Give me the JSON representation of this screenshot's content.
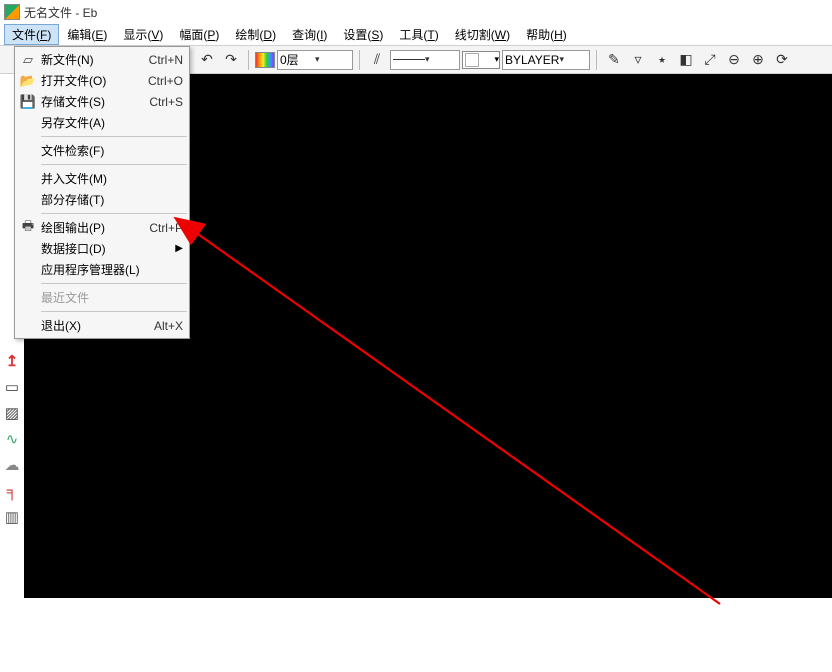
{
  "title": "无名文件 - Eb",
  "menubar": [
    {
      "label": "文件",
      "key": "F"
    },
    {
      "label": "编辑",
      "key": "E"
    },
    {
      "label": "显示",
      "key": "V"
    },
    {
      "label": "幅面",
      "key": "P"
    },
    {
      "label": "绘制",
      "key": "D"
    },
    {
      "label": "查询",
      "key": "I"
    },
    {
      "label": "设置",
      "key": "S"
    },
    {
      "label": "工具",
      "key": "T"
    },
    {
      "label": "线切割",
      "key": "W"
    },
    {
      "label": "帮助",
      "key": "H"
    }
  ],
  "toolbar": {
    "layer_label": "0层",
    "bylayer_label": "BYLAYER"
  },
  "file_menu": {
    "items": [
      {
        "icon": "new",
        "label": "新文件(N)",
        "shortcut": "Ctrl+N"
      },
      {
        "icon": "open",
        "label": "打开文件(O)",
        "shortcut": "Ctrl+O"
      },
      {
        "icon": "save",
        "label": "存储文件(S)",
        "shortcut": "Ctrl+S"
      },
      {
        "icon": "",
        "label": "另存文件(A)",
        "shortcut": ""
      },
      {
        "sep": true
      },
      {
        "icon": "",
        "label": "文件检索(F)",
        "shortcut": ""
      },
      {
        "sep": true
      },
      {
        "icon": "",
        "label": "并入文件(M)",
        "shortcut": ""
      },
      {
        "icon": "",
        "label": "部分存储(T)",
        "shortcut": ""
      },
      {
        "sep": true
      },
      {
        "icon": "print",
        "label": "绘图输出(P)",
        "shortcut": "Ctrl+P"
      },
      {
        "icon": "",
        "label": "数据接口(D)",
        "shortcut": "",
        "submenu": true
      },
      {
        "icon": "",
        "label": "应用程序管理器(L)",
        "shortcut": ""
      },
      {
        "sep": true
      },
      {
        "icon": "",
        "label": "最近文件",
        "shortcut": "",
        "disabled": true
      },
      {
        "sep": true
      },
      {
        "icon": "",
        "label": "退出(X)",
        "shortcut": "Alt+X"
      }
    ]
  }
}
